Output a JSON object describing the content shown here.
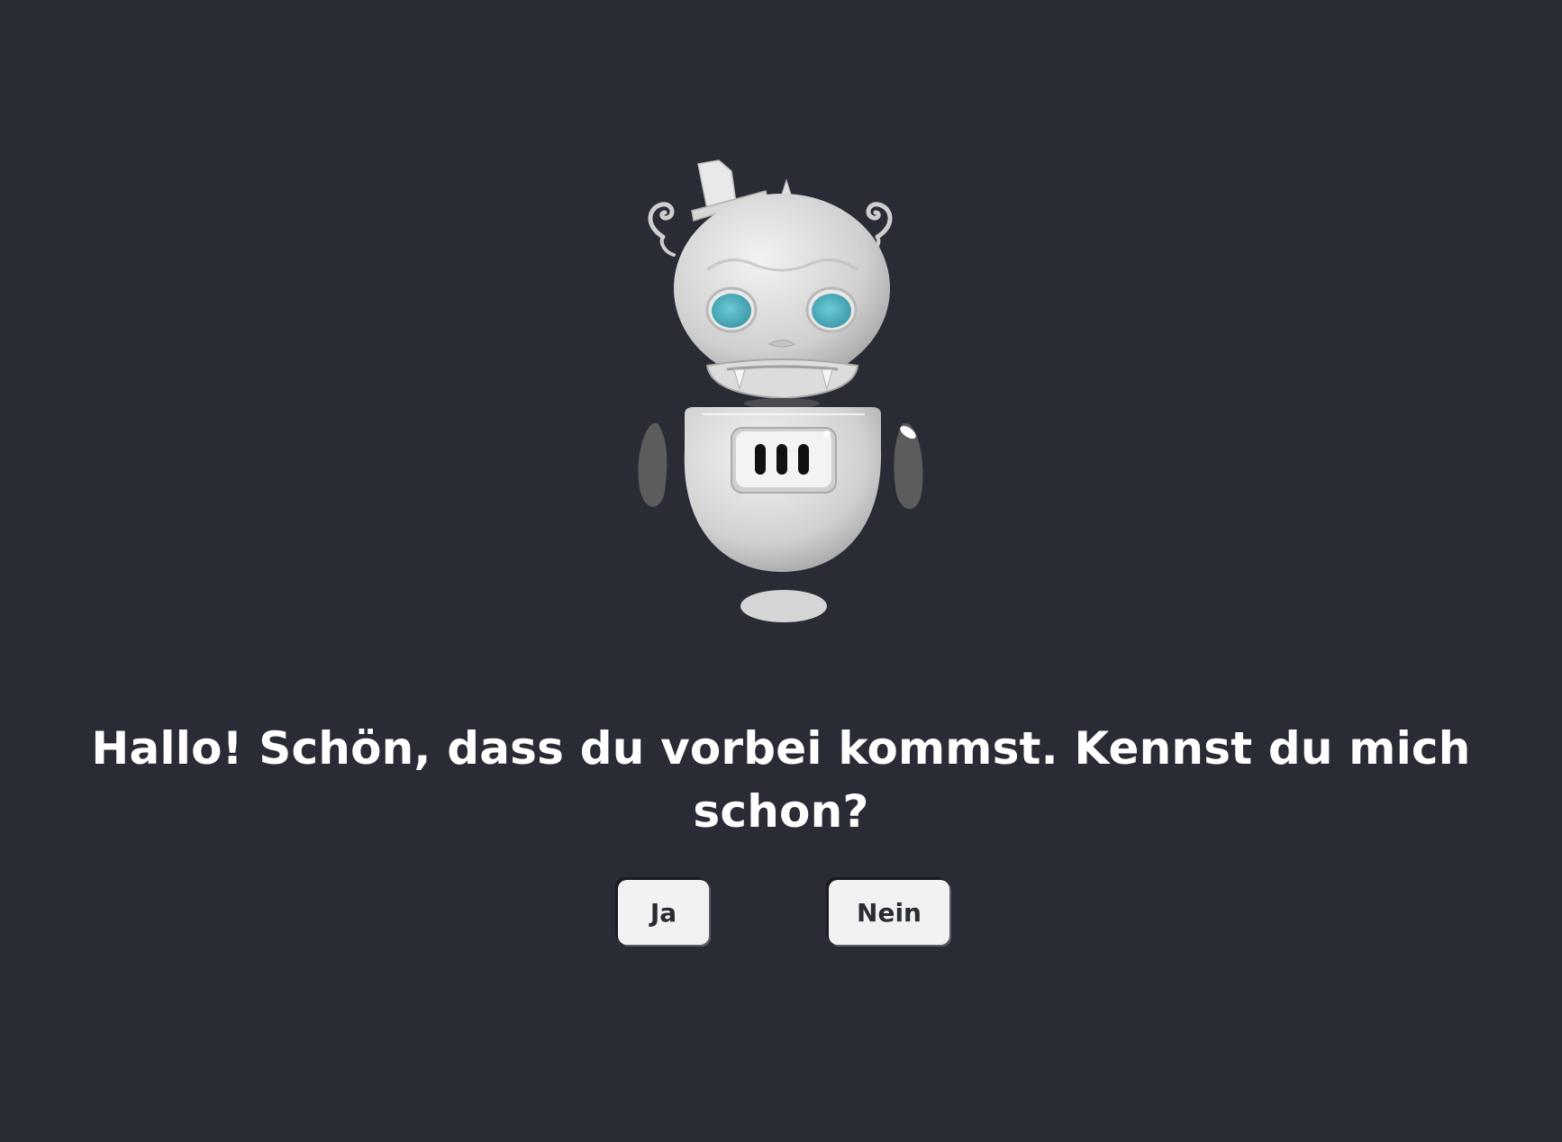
{
  "avatar": {
    "icon": "robot-mascot-icon",
    "eye_color": "#4fb3c1",
    "body_color": "#d9d9d9",
    "arm_color": "#5c5c5c"
  },
  "dialog": {
    "message": "Hallo! Schön, dass du vorbei kommst. Kennst du mich schon?"
  },
  "buttons": {
    "yes_label": "Ja",
    "no_label": "Nein"
  },
  "colors": {
    "background": "#292c34",
    "text": "#ffffff",
    "button_bg": "#f2f2f2",
    "button_text": "#2a2d34"
  }
}
